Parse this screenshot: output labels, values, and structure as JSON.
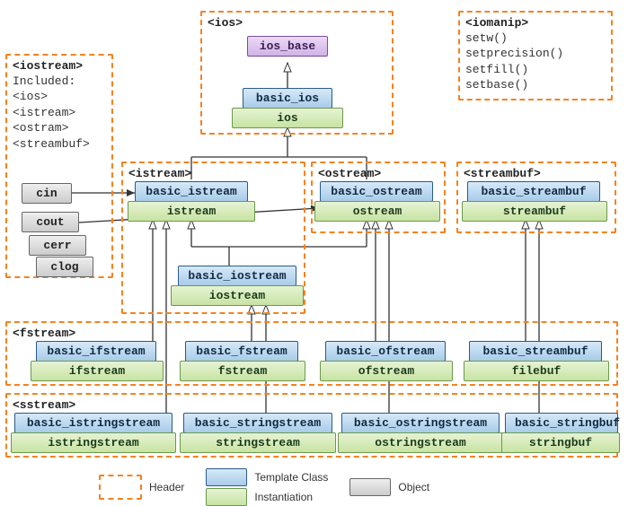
{
  "headers": {
    "ios": "<ios>",
    "istream": "<istream>",
    "ostream": "<ostream>",
    "streambuf": "<streambuf>",
    "fstream": "<fstream>",
    "sstream": "<sstream>",
    "iostream": "<iostream>",
    "iomanip": "<iomanip>"
  },
  "iostream_panel": {
    "included_label": "Included:",
    "lines": [
      "<ios>",
      "<istream>",
      "<ostram>",
      "<streambuf>"
    ]
  },
  "iomanip_panel": {
    "lines": [
      "setw()",
      "setprecision()",
      "setfill()",
      "setbase()"
    ]
  },
  "classes": {
    "ios_base": {
      "template": "ios_base"
    },
    "basic_ios": {
      "template": "basic_ios",
      "inst": "ios"
    },
    "basic_istream": {
      "template": "basic_istream",
      "inst": "istream"
    },
    "basic_ostream": {
      "template": "basic_ostream",
      "inst": "ostream"
    },
    "basic_streambuf": {
      "template": "basic_streambuf",
      "inst": "streambuf"
    },
    "basic_iostream": {
      "template": "basic_iostream",
      "inst": "iostream"
    },
    "basic_ifstream": {
      "template": "basic_ifstream",
      "inst": "ifstream"
    },
    "basic_fstream": {
      "template": "basic_fstream",
      "inst": "fstream"
    },
    "basic_ofstream": {
      "template": "basic_ofstream",
      "inst": "ofstream"
    },
    "basic_filebuf": {
      "template": "basic_streambuf",
      "inst": "filebuf"
    },
    "basic_istringstream": {
      "template": "basic_istringstream",
      "inst": "istringstream"
    },
    "basic_stringstream": {
      "template": "basic_stringstream",
      "inst": "stringstream"
    },
    "basic_ostringstream": {
      "template": "basic_ostringstream",
      "inst": "ostringstream"
    },
    "basic_stringbuf": {
      "template": "basic_stringbuf",
      "inst": "stringbuf"
    }
  },
  "objects": [
    "cin",
    "cout",
    "cerr",
    "clog"
  ],
  "legend": {
    "header": "Header",
    "template": "Template Class",
    "instantiation": "Instantiation",
    "object": "Object"
  }
}
